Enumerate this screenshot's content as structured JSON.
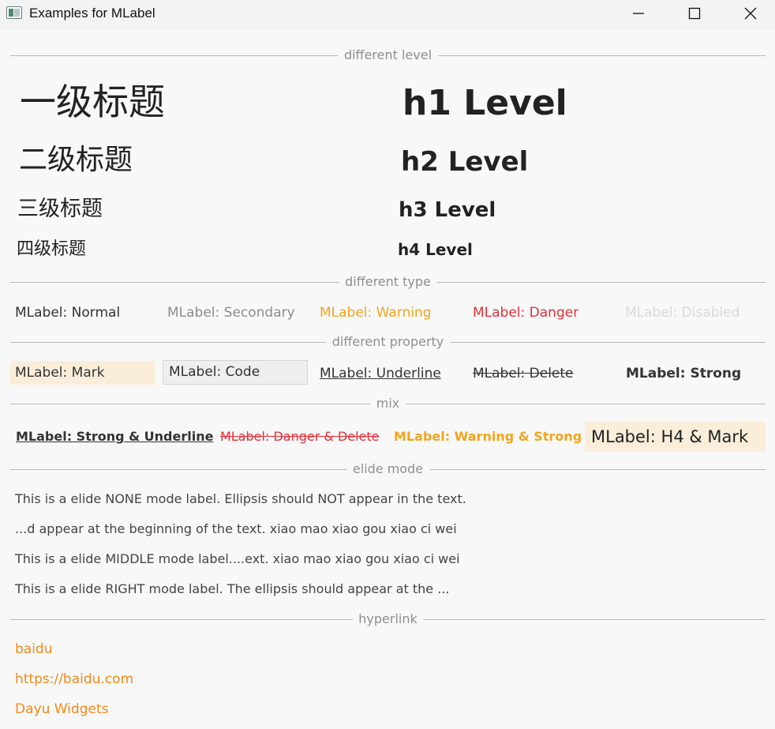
{
  "window": {
    "title": "Examples for MLabel",
    "controls": [
      "minimize-icon",
      "maximize-icon",
      "close-icon"
    ]
  },
  "sections": {
    "level": "different level",
    "type": "different type",
    "property": "different property",
    "mix": "mix",
    "elide": "elide mode",
    "hyperlink": "hyperlink"
  },
  "levels": {
    "zh": [
      "一级标题",
      "二级标题",
      "三级标题",
      "四级标题"
    ],
    "en": [
      "h1 Level",
      "h2 Level",
      "h3 Level",
      "h4 Level"
    ]
  },
  "types": {
    "normal": "MLabel: Normal",
    "secondary": "MLabel: Secondary",
    "warning": "MLabel: Warning",
    "danger": "MLabel: Danger",
    "disabled": "MLabel: Disabled"
  },
  "properties": {
    "mark": "MLabel: Mark",
    "code": "MLabel: Code",
    "underline": "MLabel: Underline",
    "delete": "MLabel: Delete",
    "strong": "MLabel: Strong"
  },
  "mix": {
    "strong_underline": "MLabel: Strong & Underline",
    "danger_delete": "MLabel: Danger & Delete",
    "warning_strong": "MLabel: Warning & Strong",
    "h4_mark": "MLabel: H4 & Mark"
  },
  "elide": {
    "none": "This is a elide NONE mode label. Ellipsis should NOT appear in the text.",
    "left": "...d appear at the beginning of the text. xiao mao xiao gou xiao ci wei",
    "middle": "This is a elide MIDDLE mode label....ext. xiao mao xiao gou xiao ci wei",
    "right": "This is a elide RIGHT mode label. The ellipsis should appear at the ..."
  },
  "links": [
    "baidu",
    "https://baidu.com",
    "Dayu Widgets"
  ],
  "colors": {
    "warning": "#f2a51f",
    "danger": "#e6303a",
    "link": "#f08a18",
    "mark_bg": "#faeedb"
  }
}
